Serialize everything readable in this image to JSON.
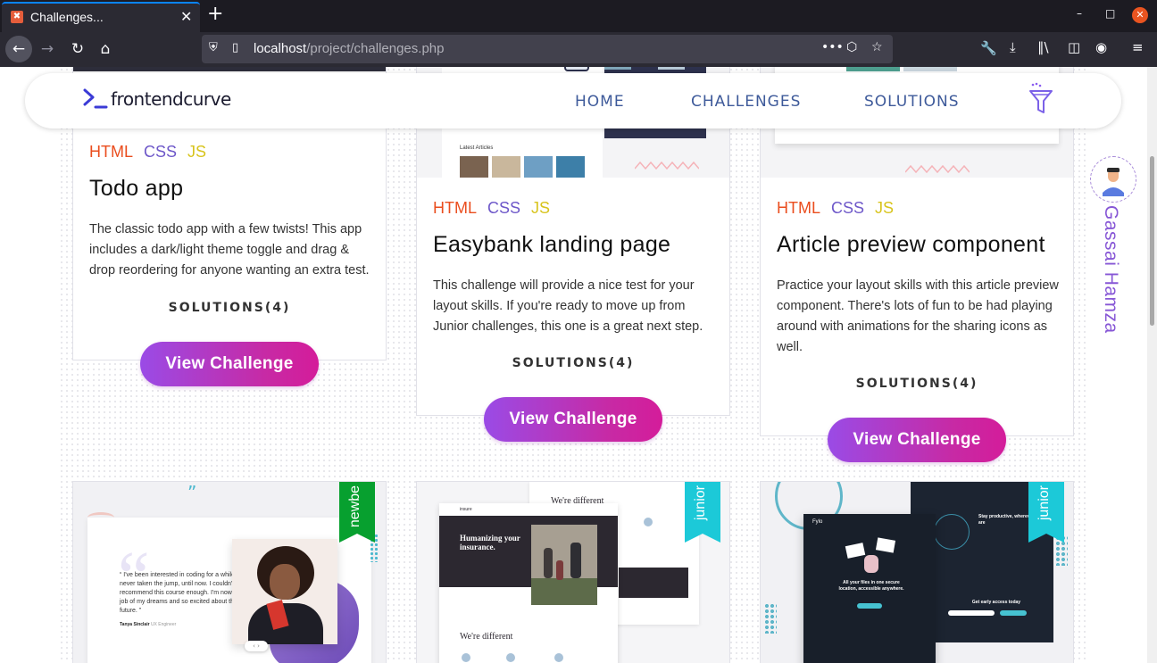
{
  "browser": {
    "tab_title": "Challenges...",
    "url_host": "localhost",
    "url_path": "/project/challenges.php"
  },
  "header": {
    "logo_text": "frontendcurve",
    "nav": [
      "HOME",
      "CHALLENGES",
      "SOLUTIONS"
    ]
  },
  "profile": {
    "name": "Gassai Hamza"
  },
  "tags": {
    "html": "HTML",
    "css": "CSS",
    "js": "JS"
  },
  "cards": [
    {
      "title": "Todo app",
      "description": "The classic todo app with a few twists! This app includes a dark/light theme toggle and drag & drop reordering for anyone wanting an extra test.",
      "solutions": "SOLUTIONS(4)",
      "button": "View Challenge"
    },
    {
      "title": "Easybank landing page",
      "description": "This challenge will provide a nice test for your layout skills. If you're ready to move up from Junior challenges, this one is a great next step.",
      "solutions": "SOLUTIONS(4)",
      "button": "View Challenge"
    },
    {
      "title": "Article preview component",
      "description": "Practice your layout skills with this article preview component. There's lots of fun to be had playing around with animations for the sharing icons as well.",
      "solutions": "SOLUTIONS(4)",
      "button": "View Challenge"
    }
  ],
  "bottom_cards": [
    {
      "ribbon": "newbe",
      "ribbon_color": "#07a02f",
      "quote": "“ I've been interested in coding for a while but never taken the jump, until now. I couldn't recommend this course enough. I'm now in the job of my dreams and so excited about the future. ”",
      "author": "Tanya Sinclair",
      "author_role": "UX Engineer"
    },
    {
      "ribbon": "junior",
      "ribbon_color": "#1cc9d8",
      "logo": "insure",
      "headline": "Humanizing your insurance.",
      "different": "We're different",
      "different2": "We're different"
    },
    {
      "ribbon": "junior",
      "ribbon_color": "#1cc9d8",
      "logo": "Fylo",
      "headline": "All your files in one secure location, accessible anywhere.",
      "productive": "Stay productive, wherever you are",
      "cta": "Get early access today"
    }
  ]
}
